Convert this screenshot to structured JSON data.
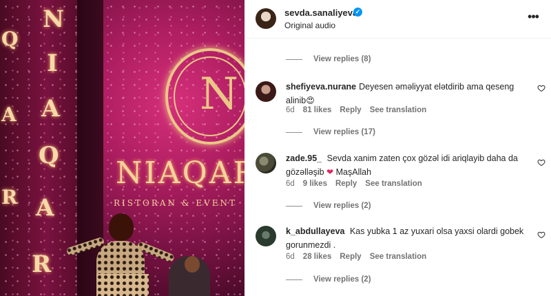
{
  "header": {
    "username": "sevda.sanaliyeva",
    "audio": "Original audio",
    "more_icon": "more-horizontal-icon"
  },
  "media": {
    "brand_letters": [
      "N",
      "I",
      "A",
      "Q",
      "A",
      "R"
    ],
    "brand": "NIAQAR",
    "brand_sub": "RISTORAN & EVENT",
    "logo_letter": "N"
  },
  "replies": [
    {
      "label": "View replies (8)"
    },
    {
      "label": "View replies (17)"
    },
    {
      "label": "View replies (2)"
    },
    {
      "label": "View replies (2)"
    }
  ],
  "comments": [
    {
      "author": "shefiyeva.nurane",
      "text": "Deyesen əməliyyat elətdirib ama qeseng alinib",
      "emoji": "😍",
      "age": "6d",
      "likes": "81 likes",
      "reply": "Reply",
      "translate": "See translation"
    },
    {
      "author": "zade.95_",
      "text": "Sevda xanim zaten çox gözəl idi ariqlayib daha da gözəlləşib",
      "emoji": "❤",
      "text_after": "MaşAllah",
      "age": "6d",
      "likes": "9 likes",
      "reply": "Reply",
      "translate": "See translation"
    },
    {
      "author": "k_abdullayeva",
      "text": "Kas yubka 1 az yuxari olsa yaxsi olardi gobek gorunmezdi .",
      "age": "6d",
      "likes": "28 likes",
      "reply": "Reply",
      "translate": "See translation"
    }
  ],
  "colors": {
    "verified": "#0095f6",
    "muted_text": "#737373",
    "heart_red": "#e0245e"
  }
}
